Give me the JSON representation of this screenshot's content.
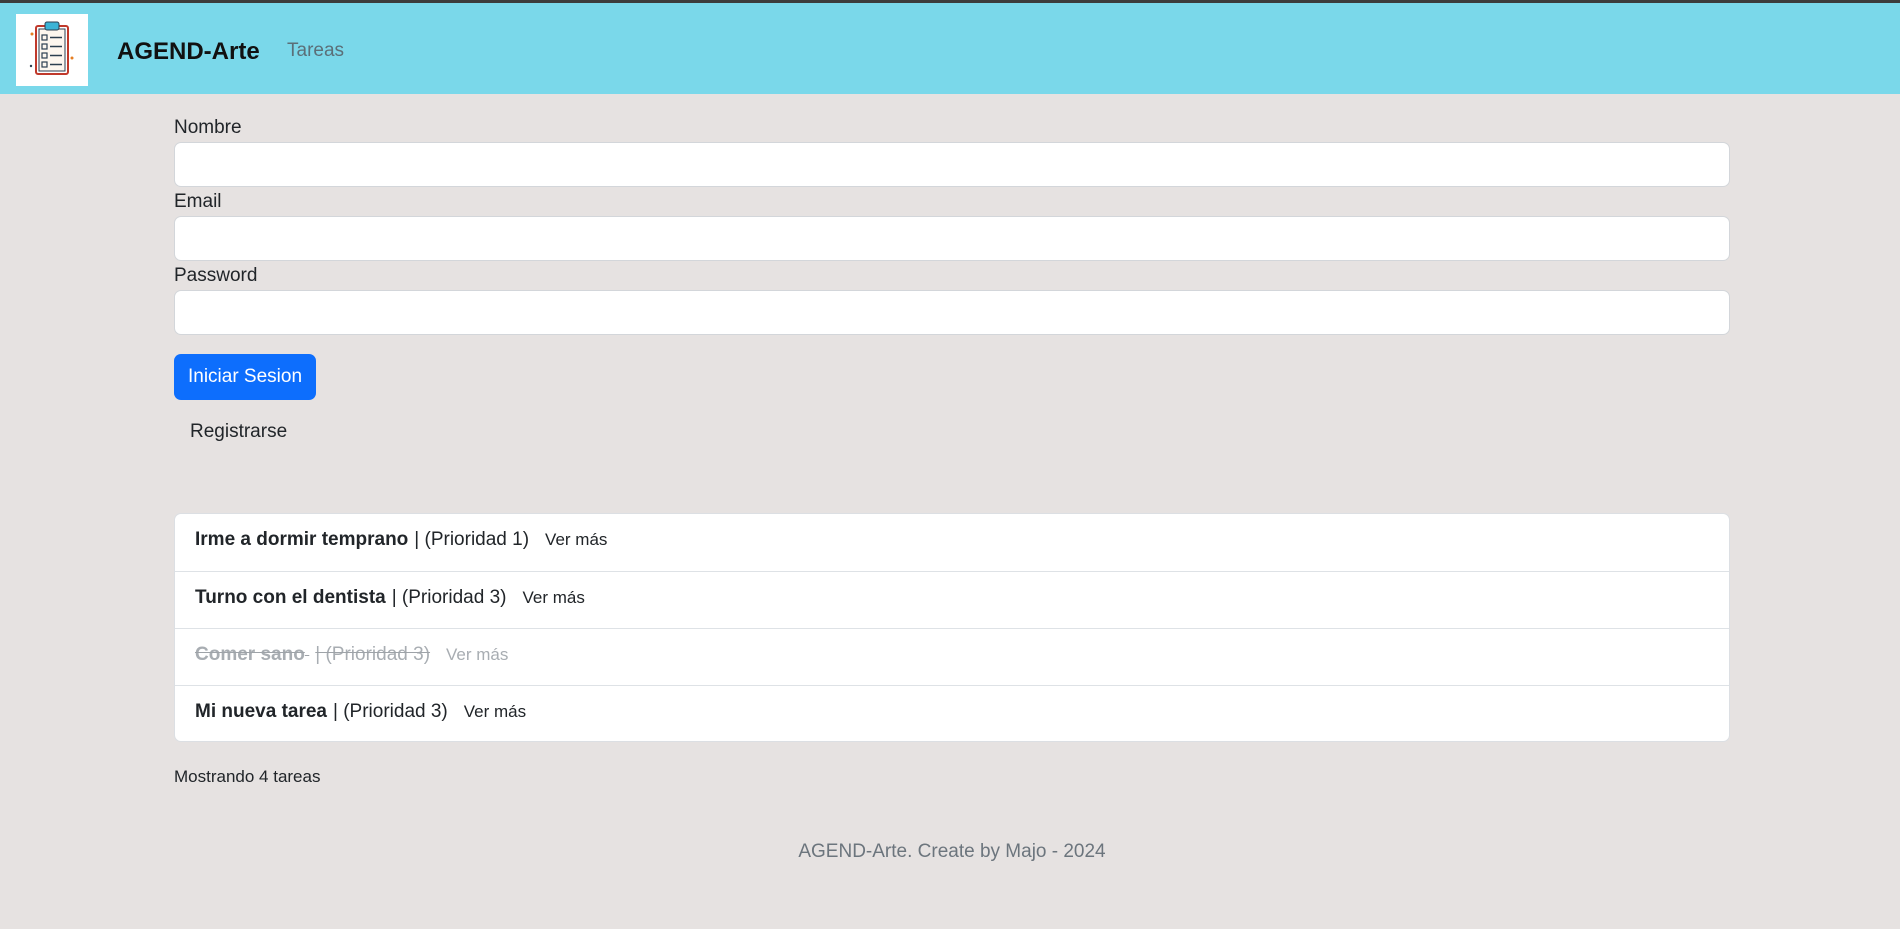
{
  "navbar": {
    "brand": "AGEND-Arte",
    "links": [
      "Tareas"
    ],
    "logo_icon": "clipboard-checklist-icon",
    "background": "#7ad8ea"
  },
  "form": {
    "name_label": "Nombre",
    "name_value": "",
    "email_label": "Email",
    "email_value": "",
    "password_label": "Password",
    "password_value": "",
    "login_button": "Iniciar Sesion",
    "register_button": "Registrarse",
    "primary_color": "#0d6efd"
  },
  "tasks": [
    {
      "title": "Irme a dormir temprano",
      "priority": "| (Prioridad 1)",
      "more": "Ver más",
      "completed": false
    },
    {
      "title": "Turno con el dentista",
      "priority": "| (Prioridad 3)",
      "more": "Ver más",
      "completed": false
    },
    {
      "title": "Comer sano",
      "priority": "| (Prioridad 3)",
      "more": "Ver más",
      "completed": true
    },
    {
      "title": "Mi nueva tarea",
      "priority": "| (Prioridad 3)",
      "more": "Ver más",
      "completed": false
    }
  ],
  "task_count": "Mostrando 4 tareas",
  "footer": "AGEND-Arte. Create by Majo - 2024"
}
